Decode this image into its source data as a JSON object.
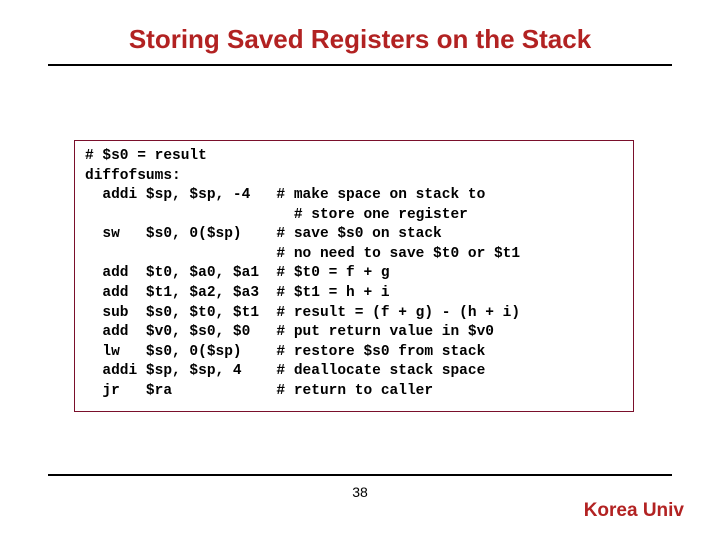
{
  "title": "Storing Saved Registers on the Stack",
  "code": "# $s0 = result\ndiffofsums:\n  addi $sp, $sp, -4   # make space on stack to\n                        # store one register\n  sw   $s0, 0($sp)    # save $s0 on stack\n                      # no need to save $t0 or $t1\n  add  $t0, $a0, $a1  # $t0 = f + g\n  add  $t1, $a2, $a3  # $t1 = h + i\n  sub  $s0, $t0, $t1  # result = (f + g) - (h + i)\n  add  $v0, $s0, $0   # put return value in $v0\n  lw   $s0, 0($sp)    # restore $s0 from stack\n  addi $sp, $sp, 4    # deallocate stack space\n  jr   $ra            # return to caller",
  "page_number": "38",
  "footer_brand": "Korea Univ"
}
